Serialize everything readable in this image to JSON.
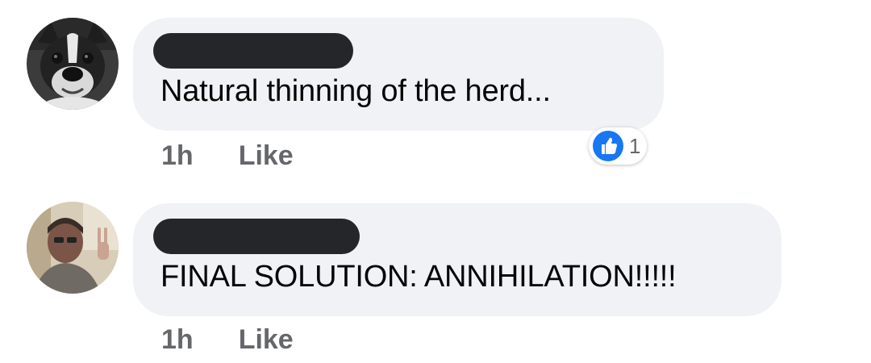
{
  "comments": [
    {
      "avatar": "dog-profile-photo",
      "text": "Natural thinning of the herd...",
      "time": "1h",
      "like_label": "Like",
      "reaction_icon": "thumbs-up-icon",
      "reaction_count": "1",
      "colors": {
        "bubble": "#f0f2f5",
        "redaction": "#24262a",
        "like_blue": "#1877f2"
      }
    },
    {
      "avatar": "man-profile-photo",
      "text": "FINAL SOLUTION: ANNIHILATION!!!!!",
      "time": "1h",
      "like_label": "Like"
    }
  ]
}
